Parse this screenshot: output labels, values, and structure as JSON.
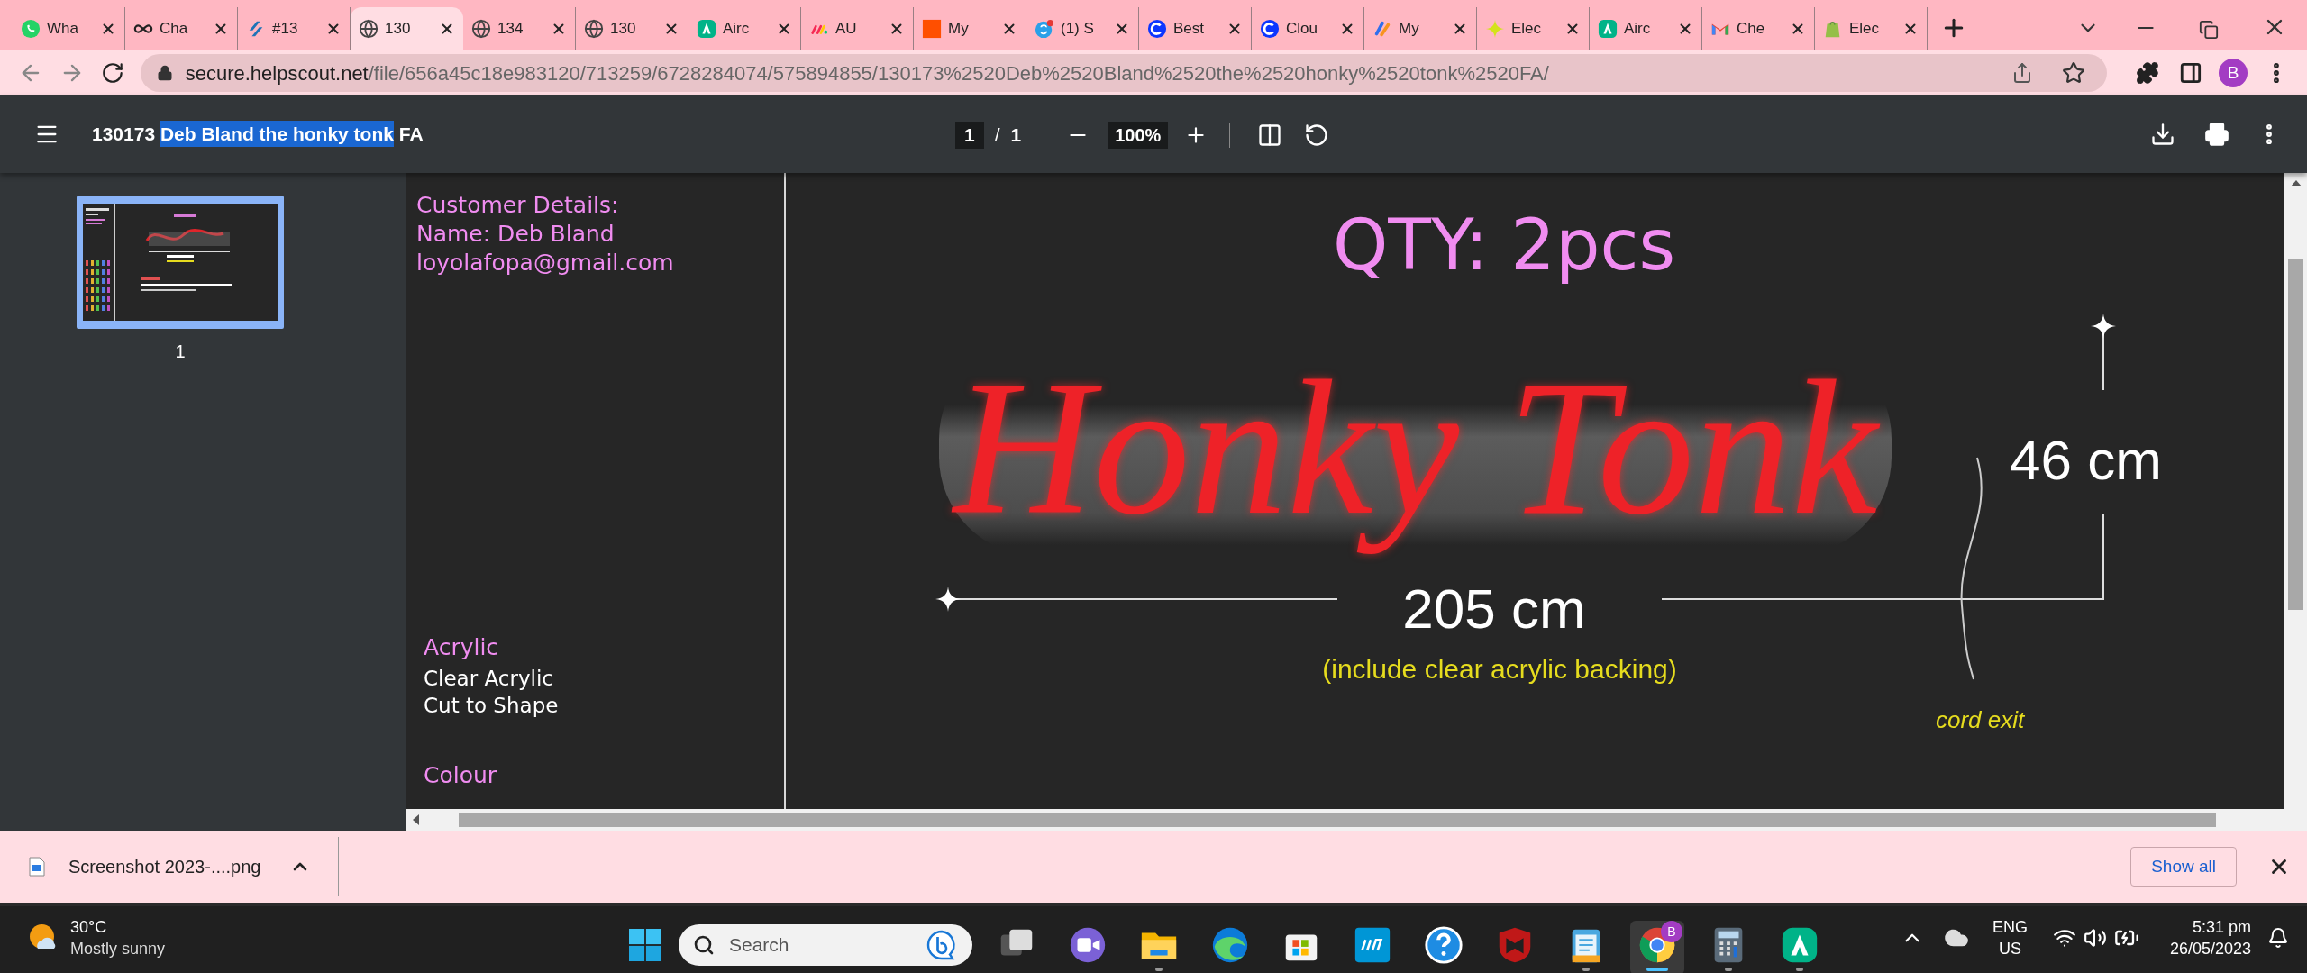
{
  "browser": {
    "tabs": [
      {
        "title": "Wha",
        "kind": "whatsapp",
        "selected": false
      },
      {
        "title": "Cha",
        "kind": "loop",
        "selected": false
      },
      {
        "title": "#13",
        "kind": "stripes",
        "selected": false
      },
      {
        "title": "130",
        "kind": "globe",
        "selected": true
      },
      {
        "title": "134",
        "kind": "globe",
        "selected": false
      },
      {
        "title": "130",
        "kind": "globe",
        "selected": false
      },
      {
        "title": "Airc",
        "kind": "peak",
        "selected": false
      },
      {
        "title": "AU",
        "kind": "dots",
        "selected": false
      },
      {
        "title": "My",
        "kind": "square",
        "selected": false
      },
      {
        "title": "(1) S",
        "kind": "bubble",
        "selected": false
      },
      {
        "title": "Best",
        "kind": "ring",
        "selected": false
      },
      {
        "title": "Clou",
        "kind": "ring",
        "selected": false
      },
      {
        "title": "My",
        "kind": "bars",
        "selected": false
      },
      {
        "title": "Elec",
        "kind": "sparkle",
        "selected": false
      },
      {
        "title": "Airc",
        "kind": "peak",
        "selected": false
      },
      {
        "title": "Che",
        "kind": "mail",
        "selected": false
      },
      {
        "title": "Elec",
        "kind": "bag",
        "selected": false
      }
    ],
    "url_host": "secure.helpscout.net",
    "url_path": "/file/656a45c18e983120/713259/6728284074/575894855/130173%2520Deb%2520Bland%2520the%2520honky%2520tonk%2520FA/",
    "profile_initial": "B"
  },
  "pdf_viewer": {
    "title_prefix": "130173",
    "title_selected": "Deb Bland the honky tonk",
    "title_suffix": "FA",
    "page_current": "1",
    "page_separator": "/",
    "page_count": "1",
    "zoom": "100%",
    "thumbnail_label": "1"
  },
  "document": {
    "customer_lines": [
      "Customer Details:",
      "Name: Deb Bland",
      "loyolafopa@gmail.com"
    ],
    "material_heading": "Acrylic",
    "material_lines": [
      "Clear Acrylic",
      "Cut to Shape"
    ],
    "colour_heading": "Colour",
    "qty": "QTY: 2pcs",
    "sign_text": "Honky Tonk",
    "height": "46 cm",
    "width": "205 cm",
    "backing_note": "(include clear acrylic backing)",
    "cord_label": "cord exit"
  },
  "downloads": {
    "file": "Screenshot 2023-....png",
    "show_all": "Show all"
  },
  "taskbar": {
    "temperature": "30°C",
    "weather": "Mostly sunny",
    "search_placeholder": "Search",
    "apps": [
      {
        "kind": "taskview",
        "running": false,
        "selected": false
      },
      {
        "kind": "video",
        "running": false,
        "selected": false
      },
      {
        "kind": "folder",
        "running": true,
        "selected": false
      },
      {
        "kind": "edge",
        "running": false,
        "selected": false
      },
      {
        "kind": "store",
        "running": false,
        "selected": false
      },
      {
        "kind": "hp",
        "running": false,
        "selected": false
      },
      {
        "kind": "help",
        "running": false,
        "selected": false
      },
      {
        "kind": "shield",
        "running": false,
        "selected": false
      },
      {
        "kind": "notepad",
        "running": true,
        "selected": false
      },
      {
        "kind": "chrome",
        "running": true,
        "selected": true,
        "badge": "B"
      },
      {
        "kind": "calculator",
        "running": true,
        "selected": false
      },
      {
        "kind": "peak",
        "running": true,
        "selected": false
      }
    ],
    "language": "ENG",
    "region": "US",
    "time": "5:31 pm",
    "date": "26/05/2023"
  }
}
